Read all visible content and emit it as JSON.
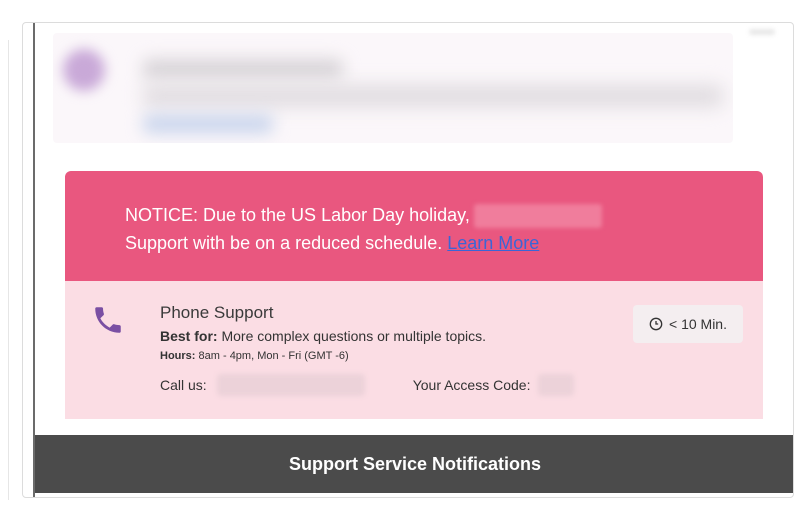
{
  "notice": {
    "text_line1": "NOTICE: Due to the US Labor Day holiday,",
    "text_line2": "Support with be on a reduced schedule.",
    "link_label": "Learn More"
  },
  "phone_support": {
    "title": "Phone Support",
    "best_for_label": "Best for:",
    "best_for_text": "More complex questions or multiple topics.",
    "hours_label": "Hours:",
    "hours_text": "8am - 4pm, Mon - Fri (GMT -6)",
    "call_label": "Call us:",
    "access_label": "Your Access Code:",
    "wait_time": "< 10 Min.",
    "icon": "phone-icon",
    "clock_icon": "clock-icon"
  },
  "footer": {
    "title": "Support Service Notifications"
  },
  "colors": {
    "notice_bg": "#e9577f",
    "card_bg": "#fbdde4",
    "link": "#3a66d6",
    "phone_icon": "#7a4fa3",
    "footer_bg": "#4b4b4b"
  }
}
